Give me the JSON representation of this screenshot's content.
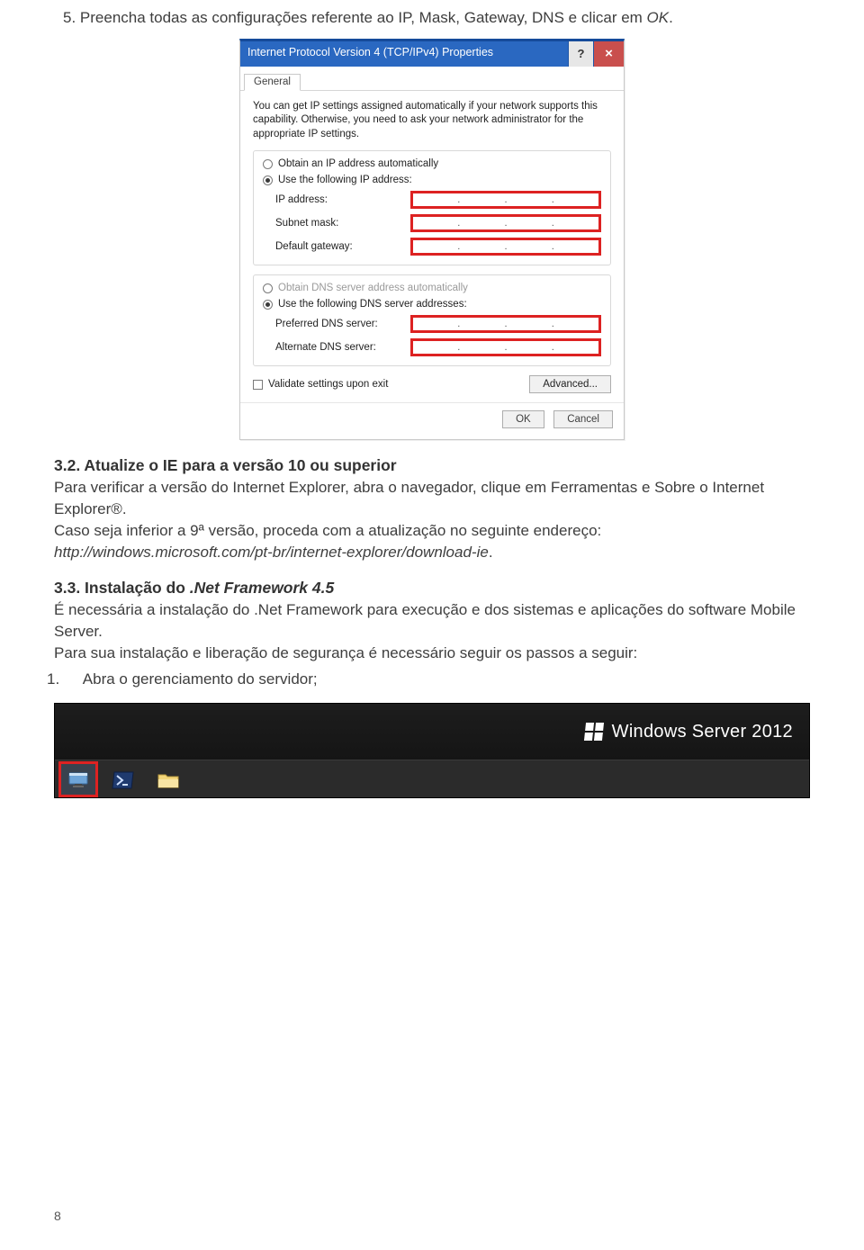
{
  "doc": {
    "step5_num": "5.",
    "step5_text": "Preencha todas as configurações referente ao IP, Mask, Gateway, DNS e clicar em ",
    "step5_ok": "OK",
    "step5_dot": ".",
    "h32": "3.2. Atualize o IE para a versão 10 ou superior",
    "p32a": "Para verificar a versão do Internet Explorer, abra o navegador, clique em Ferramentas e Sobre o Internet Explorer®.",
    "p32b": "Caso seja inferior a 9ª versão, proceda com a atualização no seguinte endereço: ",
    "p32b_url": "http://windows.microsoft.com/pt-br/internet-explorer/download-ie",
    "p32b_dot": ".",
    "h33": "3.3. Instalação do ",
    "h33_em": ".Net Framework 4.5",
    "p33a": "É necessária a instalação do .Net Framework para execução e dos sistemas e aplicações do software Mobile Server.",
    "p33b": "Para sua instalação e liberação de segurança é necessário seguir os passos a seguir:",
    "p33li1_num": "1.",
    "p33li1": "Abra o gerenciamento do servidor;"
  },
  "dialog": {
    "title": "Internet Protocol Version 4 (TCP/IPv4) Properties",
    "help": "?",
    "close": "×",
    "tab": "General",
    "hint": "You can get IP settings assigned automatically if your network supports this capability. Otherwise, you need to ask your network administrator for the appropriate IP settings.",
    "r_auto_ip": "Obtain an IP address automatically",
    "r_use_ip": "Use the following IP address:",
    "lbl_ip": "IP address:",
    "lbl_mask": "Subnet mask:",
    "lbl_gw": "Default gateway:",
    "r_auto_dns": "Obtain DNS server address automatically",
    "r_use_dns": "Use the following DNS server addresses:",
    "lbl_pdns": "Preferred DNS server:",
    "lbl_adns": "Alternate DNS server:",
    "chk_validate": "Validate settings upon exit",
    "btn_adv": "Advanced...",
    "btn_ok": "OK",
    "btn_cancel": "Cancel"
  },
  "server": {
    "brand": "Windows Server 2012"
  },
  "page_number": "8"
}
